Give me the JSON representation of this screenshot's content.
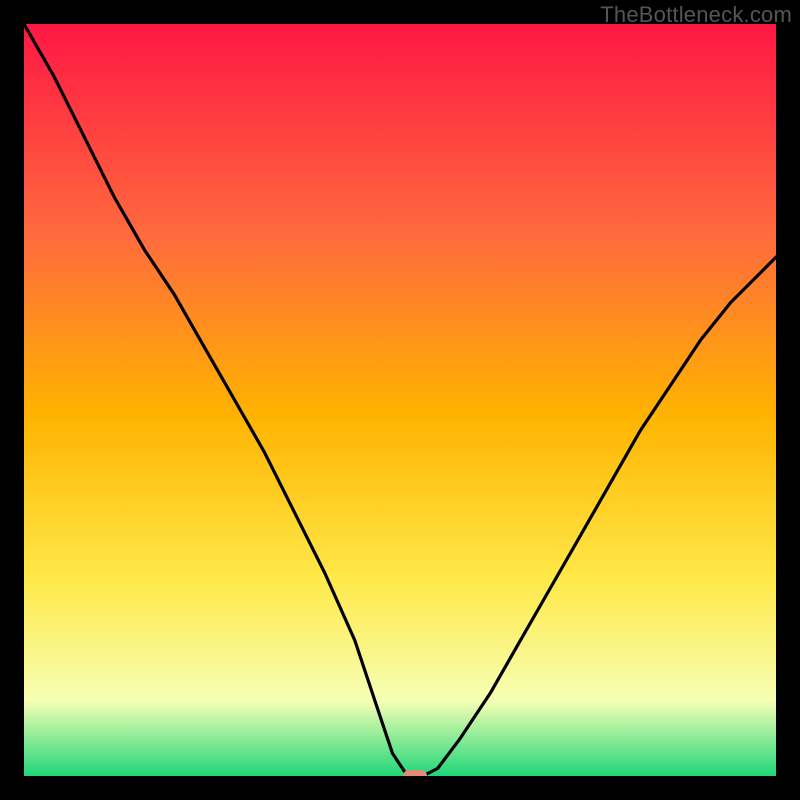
{
  "watermark": "TheBottleneck.com",
  "colors": {
    "frame": "#000000",
    "gradient_top": "#ff1744",
    "gradient_mid_upper": "#ff6a3d",
    "gradient_mid": "#ffb300",
    "gradient_mid_lower": "#ffe94a",
    "gradient_near_bottom": "#f6ffb4",
    "gradient_bottom": "#1fd67a",
    "curve": "#000000",
    "marker": "#e28b7a"
  },
  "chart_data": {
    "type": "line",
    "title": "",
    "xlabel": "",
    "ylabel": "",
    "xlim": [
      0,
      100
    ],
    "ylim": [
      0,
      100
    ],
    "series": [
      {
        "name": "bottleneck-curve",
        "x": [
          0,
          4,
          8,
          12,
          16,
          20,
          24,
          28,
          32,
          36,
          40,
          44,
          47,
          49,
          51,
          53,
          55,
          58,
          62,
          66,
          70,
          74,
          78,
          82,
          86,
          90,
          94,
          98,
          100
        ],
        "values": [
          100,
          93,
          85,
          77,
          70,
          64,
          57,
          50,
          43,
          35,
          27,
          18,
          9,
          3,
          0,
          0,
          1,
          5,
          11,
          18,
          25,
          32,
          39,
          46,
          52,
          58,
          63,
          67,
          69
        ]
      }
    ],
    "marker": {
      "x": 52,
      "y": 0
    },
    "annotations": []
  }
}
